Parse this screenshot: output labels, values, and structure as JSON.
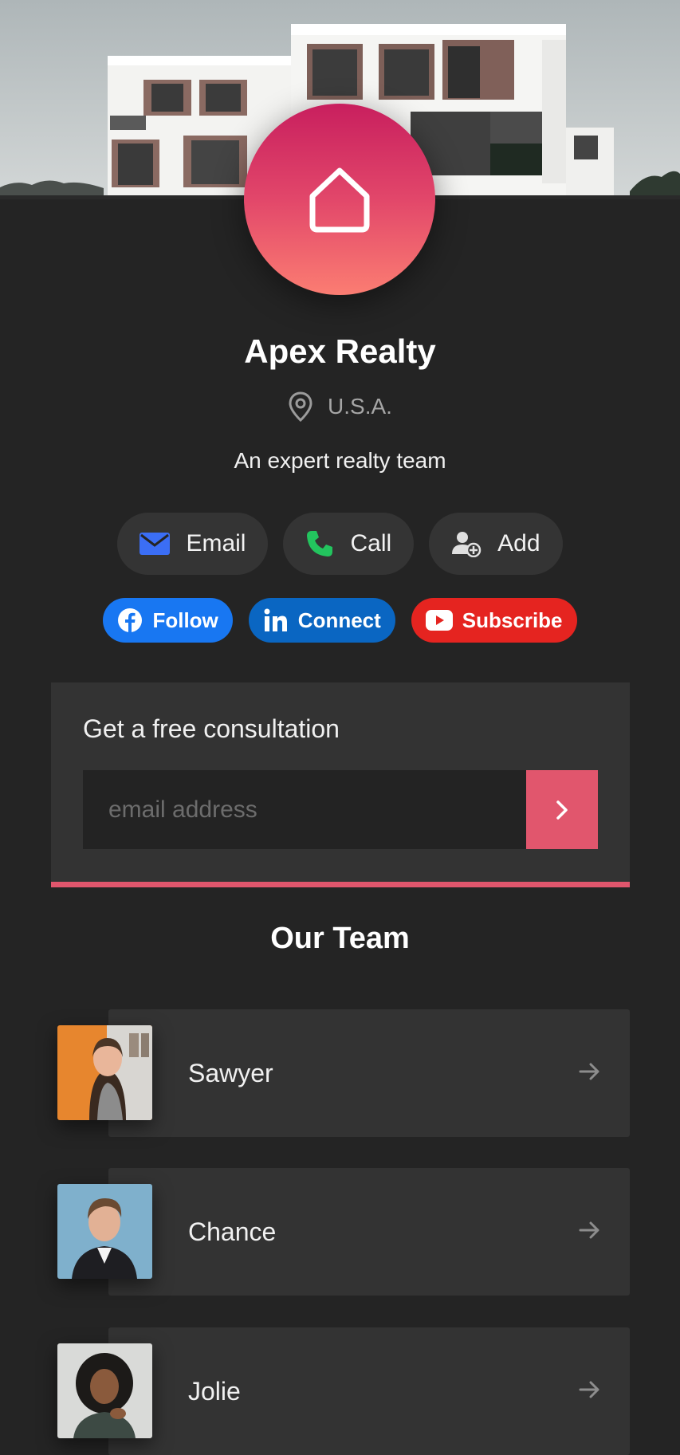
{
  "brand": {
    "name": "Apex Realty",
    "location": "U.S.A.",
    "tagline": "An expert realty team",
    "logo_icon": "house-icon",
    "accent_color": "#e1566d"
  },
  "contact_actions": [
    {
      "label": "Email",
      "icon": "mail-icon",
      "color": "#3b6ef5"
    },
    {
      "label": "Call",
      "icon": "phone-icon",
      "color": "#23c45e"
    },
    {
      "label": "Add",
      "icon": "add-contact-icon",
      "color": "#e0e0e0"
    }
  ],
  "social": [
    {
      "label": "Follow",
      "icon": "facebook-icon",
      "color": "#1877f2"
    },
    {
      "label": "Connect",
      "icon": "linkedin-icon",
      "color": "#0a66c2"
    },
    {
      "label": "Subscribe",
      "icon": "youtube-icon",
      "color": "#e52420"
    }
  ],
  "consultation": {
    "title": "Get a free consultation",
    "placeholder": "email address",
    "submit_icon": "chevron-right-icon"
  },
  "team": {
    "heading": "Our Team",
    "members": [
      {
        "name": "Sawyer",
        "icon": "arrow-right-icon"
      },
      {
        "name": "Chance",
        "icon": "arrow-right-icon"
      },
      {
        "name": "Jolie",
        "icon": "arrow-right-icon"
      }
    ]
  }
}
